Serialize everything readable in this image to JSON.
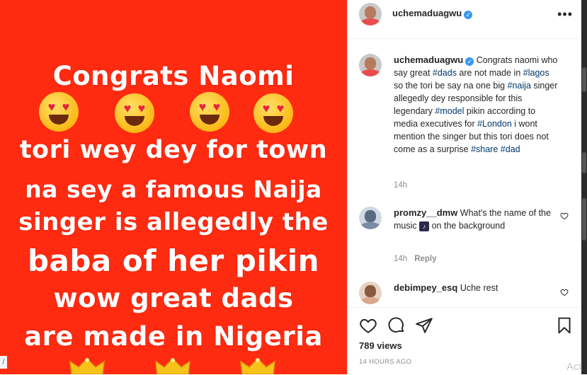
{
  "post_image": {
    "lines": [
      "Congrats Naomi",
      "tori wey dey for town",
      "na sey a famous Naija",
      "singer is allegedly the",
      "baba of her pikin",
      "wow great dads",
      "are made in Nigeria"
    ],
    "background_color": "#fe2b11",
    "emoji_icon": "heart-eyes-emoji",
    "crown_icon": "crown-emoji",
    "edge_tab": "/"
  },
  "header": {
    "username": "uchemaduagwu",
    "more_icon": "more-options-icon"
  },
  "caption": {
    "username": "uchemaduagwu",
    "segments": [
      {
        "t": "Congrats naomi who say great ",
        "tag": false
      },
      {
        "t": "#dads",
        "tag": true
      },
      {
        "t": " are not made in ",
        "tag": false
      },
      {
        "t": "#lagos",
        "tag": true
      },
      {
        "t": " so the tori be say na one big ",
        "tag": false
      },
      {
        "t": "#naija",
        "tag": true
      },
      {
        "t": " singer allegedly dey responsible for this legendary ",
        "tag": false
      },
      {
        "t": "#model",
        "tag": true
      },
      {
        "t": " pikin according to media executives for ",
        "tag": false
      },
      {
        "t": "#London",
        "tag": true
      },
      {
        "t": " i wont mention the singer but this tori does not come as a surprise ",
        "tag": false
      },
      {
        "t": "#share",
        "tag": true
      },
      {
        "t": " ",
        "tag": false
      },
      {
        "t": "#dad",
        "tag": true
      }
    ],
    "time": "14h"
  },
  "comments": [
    {
      "username": "promzy__dmw",
      "text_before": "What's the name of the music ",
      "inline_icon": "music-icon",
      "text_after": " on the background",
      "time": "14h",
      "reply": "Reply"
    },
    {
      "username": "debimpey_esq",
      "text_before": "Uche rest",
      "inline_icon": "",
      "text_after": ""
    }
  ],
  "actions": {
    "icons": [
      "heart-icon",
      "comment-icon",
      "share-icon",
      "bookmark-icon"
    ],
    "views": "789 views",
    "posted": "14 HOURS AGO"
  },
  "watermark": "Act"
}
